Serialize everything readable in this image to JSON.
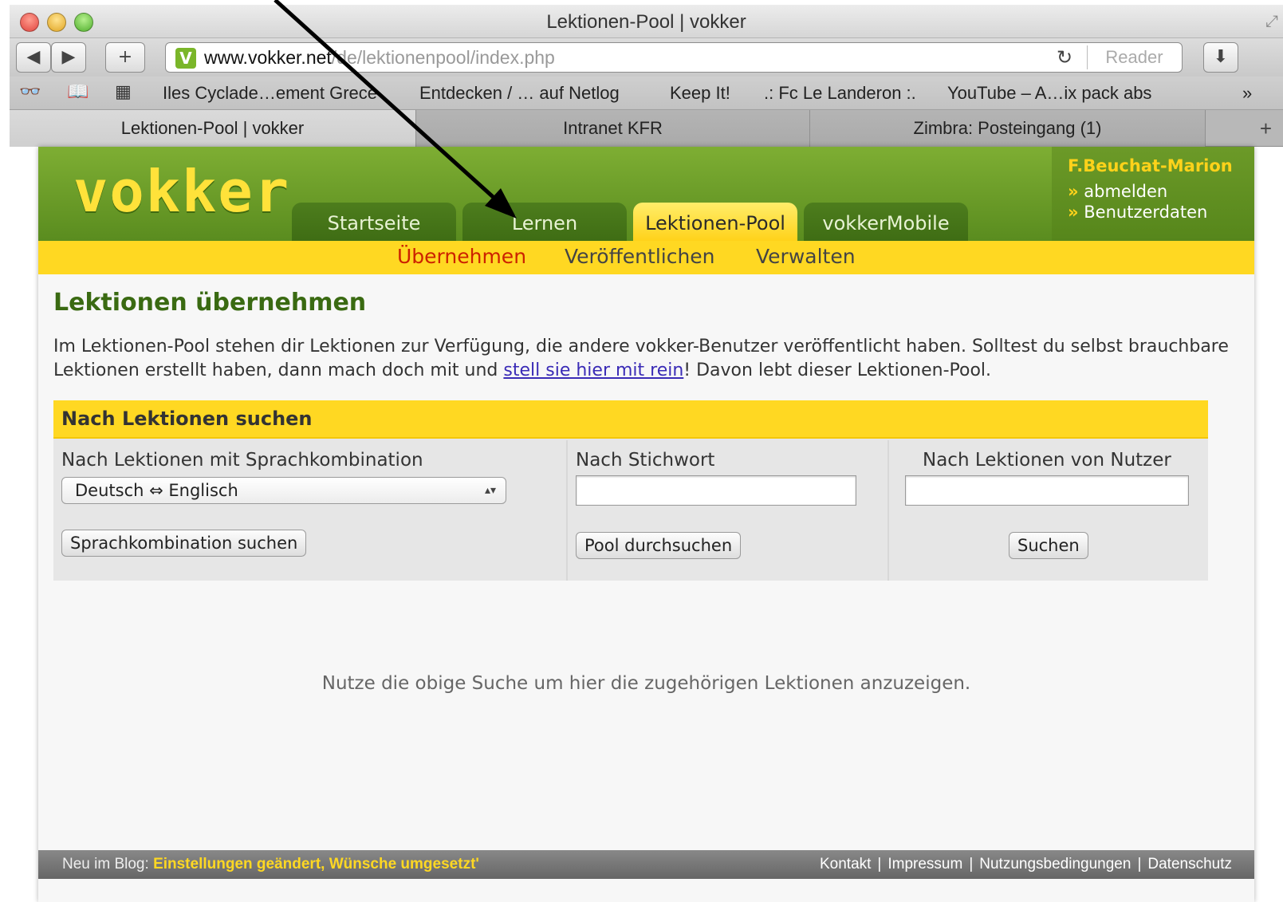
{
  "window": {
    "title": "Lektionen-Pool | vokker"
  },
  "toolbar": {
    "back": "◀",
    "forward": "▶",
    "add": "+",
    "url_domain": "www.vokker.net",
    "url_path": "/de/lektionenpool/index.php",
    "reload": "↻",
    "reader": "Reader",
    "favicon_letter": "V"
  },
  "bookmarks": {
    "items": [
      "Iles Cyclade…ement Grece",
      "Entdecken / … auf Netlog",
      "Keep It!",
      ".: Fc Le Landeron :.",
      "YouTube – A…ix pack abs"
    ],
    "more": "»"
  },
  "tabs": [
    {
      "label": "Lektionen-Pool | vokker"
    },
    {
      "label": "Intranet KFR"
    },
    {
      "label": "Zimbra: Posteingang (1)"
    }
  ],
  "site": {
    "logo": "vokker",
    "nav": [
      "Startseite",
      "Lernen",
      "Lektionen-Pool",
      "vokkerMobile"
    ],
    "active_nav": "Lektionen-Pool",
    "user": {
      "name": "F.Beuchat-Marion",
      "logout": "abmelden",
      "settings": "Benutzerdaten",
      "bullet": "»"
    },
    "subnav": [
      "Übernehmen",
      "Veröffentlichen",
      "Verwalten"
    ]
  },
  "main": {
    "heading": "Lektionen übernehmen",
    "intro_before": "Im Lektionen-Pool stehen dir Lektionen zur Verfügung, die andere vokker-Benutzer veröffentlicht haben. Solltest du selbst brauchbare Lektionen erstellt haben, dann mach doch mit und ",
    "intro_link": "stell sie hier mit rein",
    "intro_after": "! Davon lebt dieser Lektionen-Pool.",
    "search": {
      "title": "Nach Lektionen suchen",
      "col1_label": "Nach Lektionen mit Sprachkombination",
      "language_selected": "Deutsch ⇔ Englisch",
      "col1_button": "Sprachkombination suchen",
      "col2_label": "Nach Stichwort",
      "keyword_value": "",
      "col2_button": "Pool durchsuchen",
      "col3_label": "Nach Lektionen von Nutzer",
      "user_value": "",
      "col3_button": "Suchen"
    },
    "empty_hint": "Nutze die obige Suche um hier die zugehörigen Lektionen anzuzeigen."
  },
  "footer": {
    "blog_prefix": "Neu im Blog:",
    "blog_post": "Einstellungen geändert, Wünsche umgesetzt",
    "blog_suffix": "'",
    "links": [
      "Kontakt",
      "Impressum",
      "Nutzungsbedingungen",
      "Datenschutz"
    ],
    "separator": "|"
  }
}
